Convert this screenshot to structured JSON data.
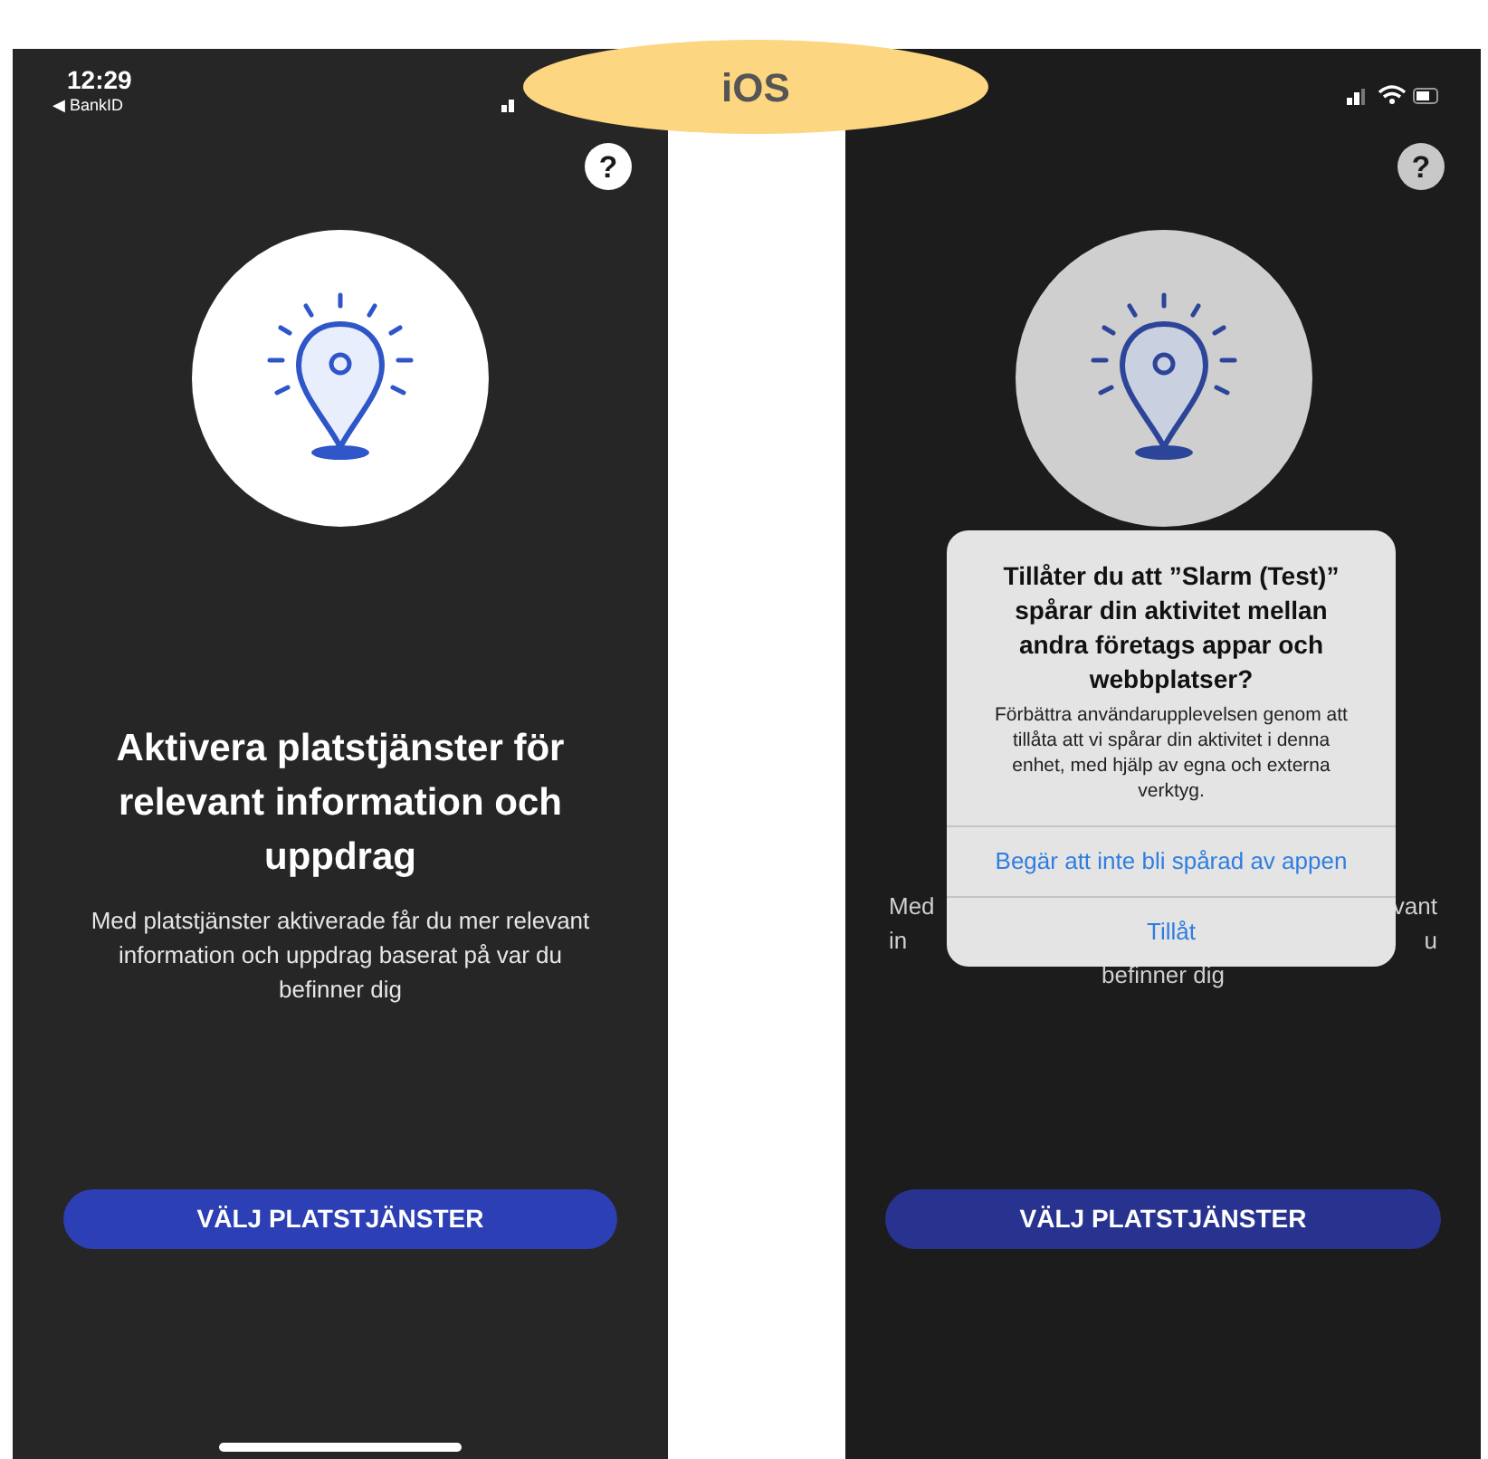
{
  "badge": {
    "label": "iOS"
  },
  "screens": [
    {
      "kind": "plain",
      "status_bar": {
        "time": "12:29",
        "back_label": "◀ BankID"
      },
      "help": "?",
      "title": "Aktivera platstjänster för relevant information och uppdrag",
      "body": "Med platstjänster aktiverade får du mer relevant information och uppdrag baserat på var du befinner dig",
      "button": "VÄLJ PLATSTJÄNSTER",
      "home_indicator": true
    },
    {
      "kind": "dialog",
      "help": "?",
      "body_lines": [
        [
          "Med",
          "vant"
        ],
        [
          "in",
          "u"
        ],
        [
          "befinner dig"
        ]
      ],
      "dialog": {
        "title": "Tillåter du att ”Slarm (Test)” spårar din aktivitet mellan andra företags appar och webbplatser?",
        "message": "Förbättra användarupplevelsen genom att tillåta att vi spårar din aktivitet i denna enhet, med hjälp av egna och externa verktyg.",
        "actions": [
          "Begär att inte bli spårad av appen",
          "Tillåt"
        ]
      },
      "button": "VÄLJ PLATSTJÄNSTER",
      "home_indicator": false
    }
  ]
}
